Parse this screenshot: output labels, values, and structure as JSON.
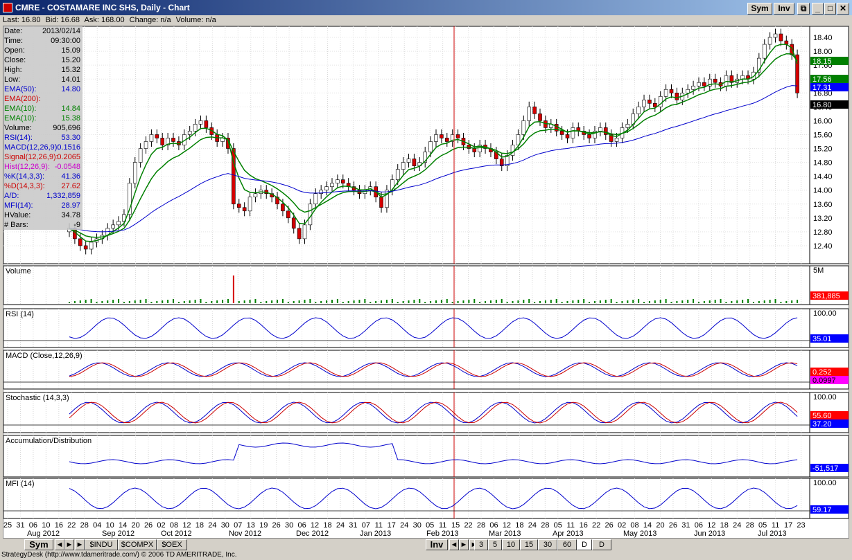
{
  "window": {
    "title": "CMRE - COSTAMARE INC SHS, Daily - Chart",
    "sym_button": "Sym",
    "inv_button": "Inv"
  },
  "quote": {
    "last": "Last: 16.80",
    "bid": "Bid: 16.68",
    "ask": "Ask: 168.00",
    "change": "Change: n/a",
    "volume": "Volume: n/a"
  },
  "info": [
    {
      "label": "Date:",
      "value": "2013/02/14",
      "color": "#000000"
    },
    {
      "label": "Time:",
      "value": "09:30:00",
      "color": "#000000"
    },
    {
      "label": "Open:",
      "value": "15.09",
      "color": "#000000"
    },
    {
      "label": "Close:",
      "value": "15.20",
      "color": "#000000"
    },
    {
      "label": "High:",
      "value": "15.32",
      "color": "#000000"
    },
    {
      "label": "Low:",
      "value": "14.01",
      "color": "#000000"
    },
    {
      "label": "EMA(50):",
      "value": "14.80",
      "color": "#0000cc"
    },
    {
      "label": "EMA(200):",
      "value": "",
      "color": "#cc0000"
    },
    {
      "label": "EMA(10):",
      "value": "14.84",
      "color": "#008000"
    },
    {
      "label": "EMA(10):",
      "value": "15.38",
      "color": "#008000"
    },
    {
      "label": "Volume:",
      "value": "905,696",
      "color": "#000000"
    },
    {
      "label": "RSI(14):",
      "value": "53.30",
      "color": "#0000cc"
    },
    {
      "label": "MACD(12,26,9):",
      "value": "0.1516",
      "color": "#0000cc"
    },
    {
      "label": "Signal(12,26,9):",
      "value": "0.2065",
      "color": "#cc0000"
    },
    {
      "label": "Hist(12,26,9):",
      "value": "-0.0548",
      "color": "#cc00cc"
    },
    {
      "label": "%K(14,3,3):",
      "value": "41.36",
      "color": "#0000cc"
    },
    {
      "label": "%D(14,3,3):",
      "value": "27.62",
      "color": "#cc0000"
    },
    {
      "label": "A/D:",
      "value": "1,332,859",
      "color": "#0000cc"
    },
    {
      "label": "MFI(14):",
      "value": "28.97",
      "color": "#0000cc"
    },
    {
      "label": "HValue:",
      "value": "34.78",
      "color": "#000000"
    },
    {
      "label": "# Bars:",
      "value": "-9",
      "color": "#000000"
    }
  ],
  "price_axis": [
    "18.40",
    "18.00",
    "17.60",
    "17.20",
    "16.80",
    "16.40",
    "16.00",
    "15.60",
    "15.20",
    "14.80",
    "14.40",
    "14.00",
    "13.60",
    "13.20",
    "12.80",
    "12.40"
  ],
  "price_tags": [
    {
      "text": "18.15",
      "bg": "#008000",
      "fg": "#ffffff"
    },
    {
      "text": "17.56",
      "bg": "#008000",
      "fg": "#ffffff"
    },
    {
      "text": "17.31",
      "bg": "#0000ff",
      "fg": "#ffffff"
    },
    {
      "text": "16.80",
      "bg": "#000000",
      "fg": "#ffffff"
    }
  ],
  "panes": [
    {
      "name": "volume",
      "title": "Volume",
      "tags": [
        {
          "text": "381,885",
          "bg": "#ff0000",
          "fg": "#ffffff"
        }
      ],
      "axis": [
        "5M"
      ]
    },
    {
      "name": "rsi",
      "title": "RSI (14)",
      "tags": [
        {
          "text": "35.01",
          "bg": "#0000ff",
          "fg": "#ffffff"
        }
      ],
      "axis": [
        "100.00"
      ]
    },
    {
      "name": "macd",
      "title": "MACD (Close,12,26,9)",
      "tags": [
        {
          "text": "0.252",
          "bg": "#ff0000",
          "fg": "#ffffff"
        },
        {
          "text": "0.0997",
          "bg": "#ff00ff",
          "fg": "#000000"
        }
      ],
      "axis": []
    },
    {
      "name": "stochastic",
      "title": "Stochastic (14,3,3)",
      "tags": [
        {
          "text": "55.60",
          "bg": "#ff0000",
          "fg": "#ffffff"
        },
        {
          "text": "37.20",
          "bg": "#0000ff",
          "fg": "#ffffff"
        }
      ],
      "axis": [
        "100.00"
      ]
    },
    {
      "name": "ad",
      "title": "Accumulation/Distribution",
      "tags": [
        {
          "text": "-51,517",
          "bg": "#0000ff",
          "fg": "#ffffff"
        }
      ],
      "axis": []
    },
    {
      "name": "mfi",
      "title": "MFI (14)",
      "tags": [
        {
          "text": "59.17",
          "bg": "#0000ff",
          "fg": "#ffffff"
        }
      ],
      "axis": [
        "100.00"
      ]
    }
  ],
  "x_days": [
    "25",
    "31",
    "06",
    "10",
    "16",
    "22",
    "28",
    "04",
    "10",
    "14",
    "20",
    "26",
    "02",
    "08",
    "12",
    "18",
    "24",
    "30",
    "07",
    "13",
    "19",
    "26",
    "30",
    "06",
    "12",
    "18",
    "24",
    "31",
    "07",
    "11",
    "17",
    "24",
    "30",
    "05",
    "11",
    "15",
    "22",
    "28",
    "06",
    "12",
    "18",
    "24",
    "28",
    "05",
    "11",
    "16",
    "22",
    "26",
    "02",
    "08",
    "14",
    "20",
    "26",
    "31",
    "06",
    "12",
    "18",
    "24",
    "28",
    "05",
    "11",
    "17",
    "23"
  ],
  "x_months": [
    "Aug 2012",
    "Sep 2012",
    "Oct 2012",
    "Nov 2012",
    "Dec 2012",
    "Jan 2013",
    "Feb 2013",
    "Mar 2013",
    "Apr 2013",
    "May 2013",
    "Jun 2013",
    "Jul 2013"
  ],
  "bottom_tabs": {
    "sym": "Sym",
    "symbols": [
      "$INDU",
      "$COMPX",
      "$OEX"
    ],
    "inv": "Inv",
    "intervals": [
      "3",
      "5",
      "10",
      "15",
      "30",
      "60",
      "D",
      "D"
    ]
  },
  "status": "StrategyDesk (http://www.tdameritrade.com/) © 2006 TD AMERITRADE, Inc.",
  "chart_data": {
    "type": "candlestick",
    "title": "CMRE - COSTAMARE INC SHS, Daily - Chart",
    "ylim": [
      12.0,
      18.6
    ],
    "close": [
      12.9,
      12.6,
      12.4,
      12.3,
      12.5,
      12.6,
      12.7,
      12.9,
      13.0,
      13.1,
      13.3,
      14.2,
      14.8,
      15.2,
      15.4,
      15.6,
      15.5,
      15.3,
      15.5,
      15.4,
      15.3,
      15.6,
      15.7,
      15.9,
      16.0,
      15.8,
      15.6,
      15.4,
      15.5,
      15.2,
      13.6,
      13.5,
      13.4,
      13.8,
      13.9,
      14.0,
      13.9,
      13.8,
      13.6,
      13.4,
      13.2,
      12.9,
      12.6,
      13.0,
      13.6,
      13.9,
      14.0,
      14.1,
      14.2,
      14.3,
      14.2,
      14.1,
      14.0,
      13.9,
      14.0,
      14.1,
      13.8,
      13.5,
      14.0,
      14.3,
      14.6,
      14.8,
      14.9,
      14.7,
      14.8,
      15.1,
      15.4,
      15.6,
      15.5,
      15.4,
      15.6,
      15.5,
      15.3,
      15.2,
      15.1,
      15.3,
      15.2,
      15.1,
      14.9,
      14.7,
      15.0,
      15.3,
      15.6,
      16.0,
      16.4,
      16.2,
      16.0,
      15.8,
      15.9,
      15.7,
      15.6,
      15.5,
      15.8,
      15.7,
      15.6,
      15.5,
      15.7,
      15.8,
      15.6,
      15.4,
      15.5,
      15.8,
      15.9,
      16.2,
      16.4,
      16.6,
      16.5,
      16.4,
      16.7,
      16.9,
      16.8,
      16.6,
      16.8,
      16.9,
      17.0,
      17.1,
      17.0,
      17.2,
      17.1,
      17.0,
      17.3,
      17.1,
      17.2,
      17.3,
      17.2,
      17.4,
      17.8,
      18.2,
      18.4,
      18.5,
      18.3,
      18.2,
      17.9,
      16.8
    ],
    "ema_fast": "green",
    "ema_slow": "green",
    "ema50": "blue"
  }
}
